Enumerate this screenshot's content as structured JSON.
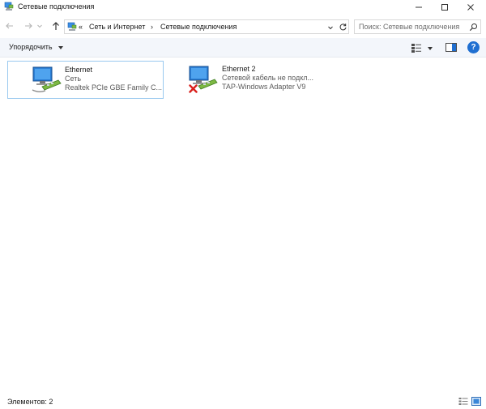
{
  "window": {
    "title": "Сетевые подключения",
    "icon": "network-connections-icon"
  },
  "address": {
    "prefix": "«",
    "breadcrumbs": [
      "Сеть и Интернет",
      "Сетевые подключения"
    ],
    "separator": "›"
  },
  "search": {
    "placeholder": "Поиск: Сетевые подключения"
  },
  "toolbar": {
    "organize_label": "Упорядочить",
    "help_label": "?"
  },
  "connections": [
    {
      "name": "Ethernet",
      "status": "Сеть",
      "device": "Realtek PCIe GBE Family C...",
      "selected": true,
      "disconnected": false
    },
    {
      "name": "Ethernet 2",
      "status": "Сетевой кабель не подкл...",
      "device": "TAP-Windows Adapter V9",
      "selected": false,
      "disconnected": true
    }
  ],
  "status_bar": {
    "count_text": "Элементов: 2"
  },
  "colors": {
    "accent": "#1f6fd1",
    "selection_border": "#99c9ef",
    "error_red": "#d9201c",
    "commandbar_bg": "#f3f6fb"
  }
}
